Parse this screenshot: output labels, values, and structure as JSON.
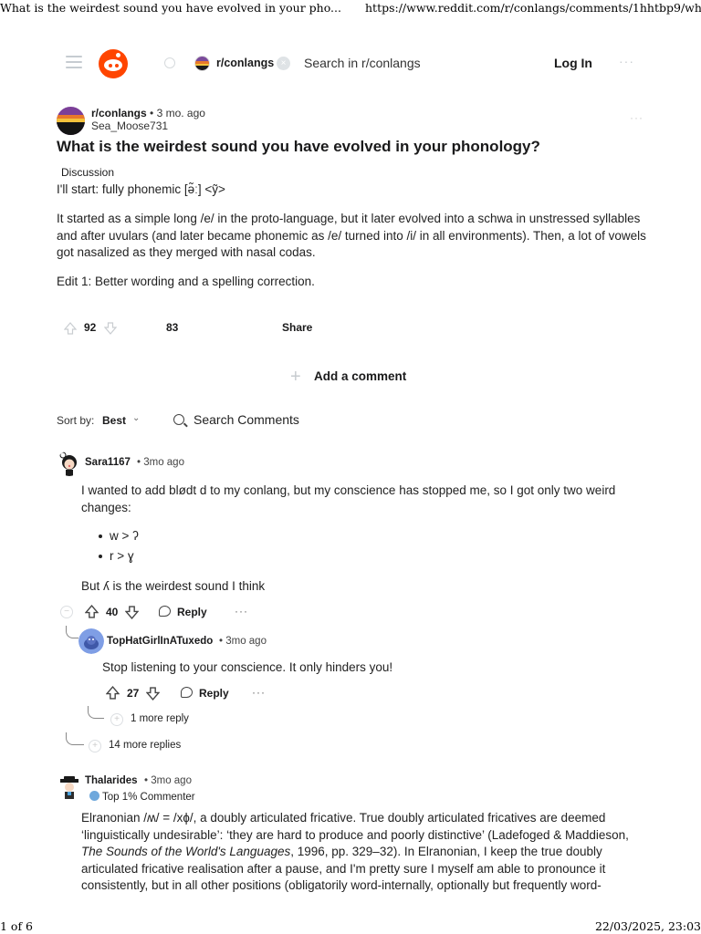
{
  "print": {
    "page_title": "What is the weirdest sound you have evolved in your pho...",
    "url": "https://www.reddit.com/r/conlangs/comments/1hhtbp9/wh...",
    "page_number": "1 of 6",
    "datetime": "22/03/2025, 23:03"
  },
  "header": {
    "subreddit_chip": "r/conlangs",
    "chip_close": "×",
    "search_placeholder": "Search in r/conlangs",
    "login_label": "Log In",
    "more": "···"
  },
  "post": {
    "subreddit": "r/conlangs",
    "age": "• 3 mo. ago",
    "author": "Sea_Moose731",
    "more": "···",
    "title": "What is the weirdest sound you have evolved in your phonology?",
    "flair": "Discussion",
    "body": [
      "I'll start: fully phonemic [ə̃ː] <ỹ>",
      "It started as a simple long /e/ in the proto-language, but it later evolved into a schwa in unstressed syllables and after uvulars (and later became phonemic as /e/ turned into /i/ in all environments). Then, a lot of vowels got nasalized as they merged with nasal codas.",
      "Edit 1: Better wording and a spelling correction."
    ],
    "upvotes": "92",
    "comments_count": "83",
    "share_label": "Share"
  },
  "add_comment_label": "Add a comment",
  "sort": {
    "label": "Sort by:",
    "value": "Best",
    "search_comments": "Search Comments"
  },
  "comments": [
    {
      "user": "Sara1167",
      "time": "• 3mo ago",
      "text1": "I wanted to add blødt d to my conlang, but my conscience has stopped me, so I got only two weird changes:",
      "list": [
        "w > ʔ",
        "r > ɣ"
      ],
      "text2": "But ʎ is the weirdest sound I think",
      "votes": "40",
      "reply_label": "Reply",
      "more": "···",
      "reply": {
        "user": "TopHatGirlInATuxedo",
        "time": "• 3mo ago",
        "text": "Stop listening to your conscience. It only hinders you!",
        "votes": "27",
        "reply_label": "Reply",
        "more": "···",
        "more_replies": "1 more reply"
      },
      "more_replies": "14 more replies"
    },
    {
      "user": "Thalarides",
      "time": "• 3mo ago",
      "badge": "Top 1% Commenter",
      "text_a": "Elranonian /ʍ/ = /xɸ/, a doubly articulated fricative. True doubly articulated fricatives are deemed ‘linguistically undesirable’: ‘they are hard to produce and poorly distinctive’ (Ladefoged & Maddieson, ",
      "text_italic": "The Sounds of the World's Languages",
      "text_b": ", 1996, pp. 329–32). In Elranonian, I keep the true doubly articulated fricative realisation after a pause, and I'm pretty sure I myself am able to pronounce it consistently, but in all other positions (obligatorily word-internally, optionally but frequently word-"
    }
  ]
}
